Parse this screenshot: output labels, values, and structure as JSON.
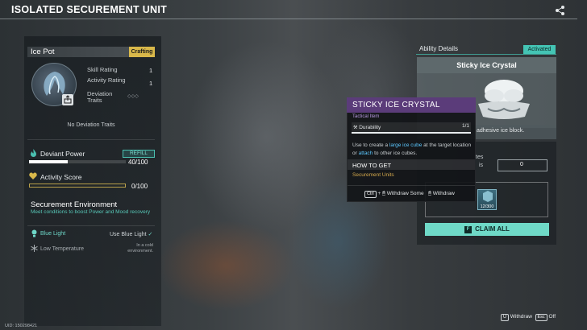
{
  "header": {
    "title": "ISOLATED SECUREMENT UNIT"
  },
  "item": {
    "name": "Ice Pot",
    "tag": "Crafting",
    "stats": [
      {
        "label": "Skill Rating",
        "value": "1"
      },
      {
        "label": "Activity Rating",
        "value": "1"
      },
      {
        "label": "Deviation Traits",
        "value": ""
      }
    ],
    "no_traits": "No Deviation Traits"
  },
  "deviant_power": {
    "label": "Deviant Power",
    "refill_label": "REFILL",
    "current": 40,
    "max": 100,
    "value_text": "40/100"
  },
  "activity_score": {
    "label": "Activity Score",
    "current": 0,
    "max": 100,
    "value_text": "0/100"
  },
  "environment": {
    "title": "Securement Environment",
    "description": "Meet conditions to boost Power and Mood recovery",
    "conditions": [
      {
        "label": "Blue Light",
        "requirement": "Use Blue Light",
        "met": true
      },
      {
        "label": "Low Temperature",
        "requirement": "In a cold environment.",
        "met": false
      }
    ]
  },
  "ability": {
    "section_label": "Ability Details",
    "status": "Activated",
    "name": "Sticky Ice Crystal",
    "description_fragment": "adhesive ice block."
  },
  "right_panel": {
    "fragment_1": "tes",
    "fragment_2": "is",
    "slot_text": "0",
    "inventory_count": "12/300",
    "claim_label": "CLAIM ALL",
    "claim_key": "F"
  },
  "tooltip": {
    "title": "STICKY ICE CRYSTAL",
    "type": "Tactical Item",
    "durability_label": "Durability",
    "durability_value": "1/1",
    "desc_1": "Use to create a ",
    "desc_hl_1": "large ice cube",
    "desc_2": " at the target location or ",
    "desc_hl_2": "attach",
    "desc_3": " to other ice cubes.",
    "how_to_get": "HOW TO GET",
    "source": "Securement Units",
    "action_key": "Ctrl",
    "action_plus": "+",
    "action_1": "Withdraw Some",
    "action_2": "Withdraw"
  },
  "footer": {
    "uid": "UID: 150298421",
    "withdraw_key": "U",
    "withdraw_label": "Withdraw",
    "off_key": "Esc",
    "off_label": "Off"
  },
  "colors": {
    "accent": "#44c4b4",
    "gold": "#d9b84a",
    "tooltip_purple": "#5b3c7a",
    "highlight_blue": "#5cc8ff"
  }
}
